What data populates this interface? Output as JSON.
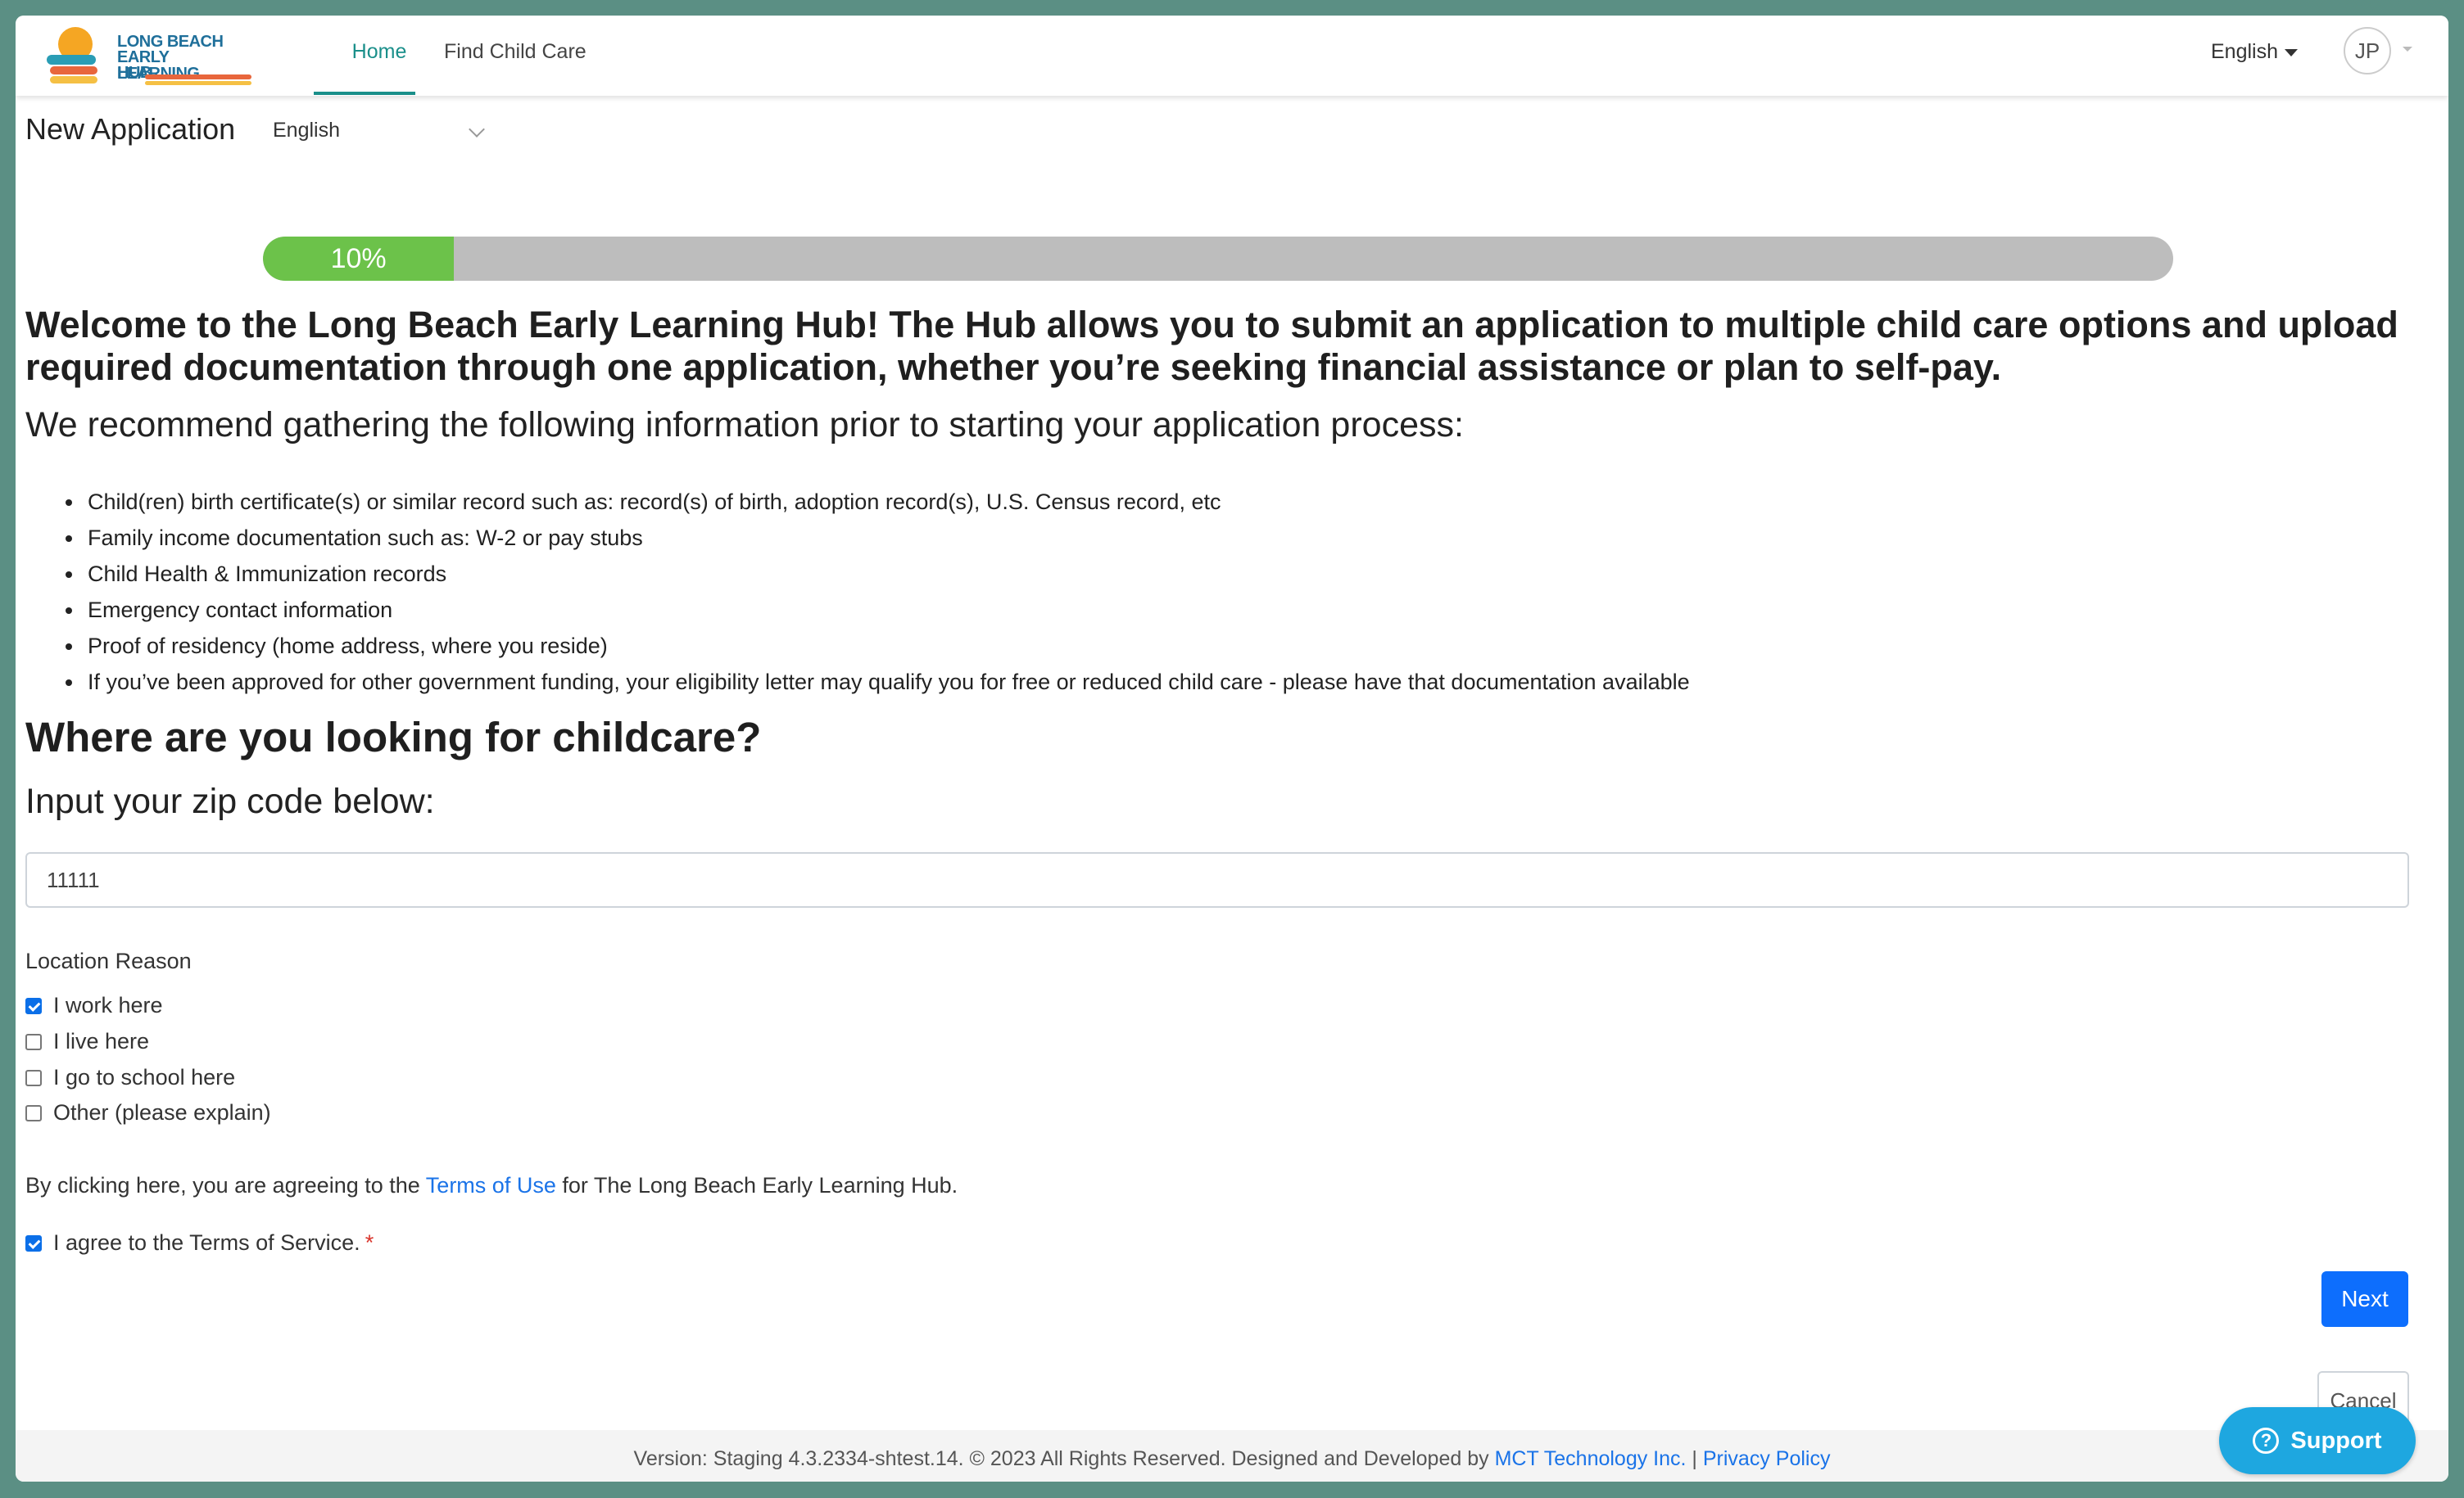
{
  "nav": {
    "logo": {
      "line1": "LONG BEACH",
      "line2": "EARLY LEARNING",
      "line3": "HUB"
    },
    "home": "Home",
    "find_child_care": "Find Child Care",
    "language": "English",
    "avatar_initials": "JP"
  },
  "header": {
    "title": "New Application",
    "language_select": "English"
  },
  "progress": {
    "label": "10%",
    "value": 0.1
  },
  "content": {
    "welcome": "Welcome to the Long Beach Early Learning Hub! The Hub allows you to submit an application to multiple child care options and upload required documentation through one application, whether you’re seeking financial assistance or plan to self-pay.",
    "recommend": "We recommend gathering the following information prior to starting your application process:",
    "bullets": [
      "Child(ren) birth certificate(s) or similar record such as: record(s) of birth, adoption record(s), U.S. Census record, etc",
      "Family income documentation such as: W-2 or pay stubs",
      "Child Health & Immunization records",
      "Emergency contact information",
      "Proof of residency (home address, where you reside)",
      "If you’ve been approved for other government funding, your eligibility letter may qualify you for free or reduced child care - please have that documentation available"
    ],
    "where_heading": "Where are you looking for childcare?",
    "zip_label": "Input your zip code below:",
    "zip_value": "11111",
    "location_reason_label": "Location Reason",
    "reasons": [
      {
        "label": "I work here",
        "checked": true
      },
      {
        "label": "I live here",
        "checked": false
      },
      {
        "label": "I go to school here",
        "checked": false
      },
      {
        "label": "Other (please explain)",
        "checked": false
      }
    ],
    "terms_prefix": "By clicking here, you are agreeing to the ",
    "terms_link": "Terms of Use",
    "terms_suffix": " for The Long Beach Early Learning Hub.",
    "agree_label": "I agree to the Terms of Service.",
    "required_mark": "*"
  },
  "buttons": {
    "next": "Next",
    "cancel": "Cancel",
    "support": "Support"
  },
  "footer": {
    "text": "Version: Staging 4.3.2334-shtest.14. © 2023 All Rights Reserved. Designed and Developed by ",
    "company_link": "MCT Technology Inc.",
    "separator": " | ",
    "privacy_link": "Privacy Policy"
  }
}
